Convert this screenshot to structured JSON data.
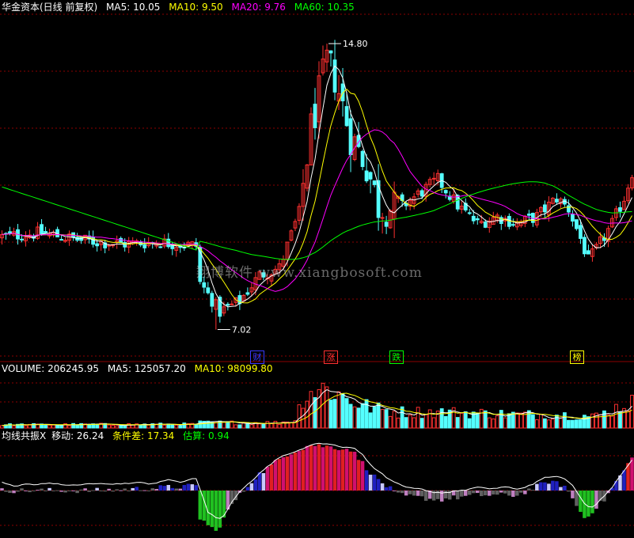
{
  "title": "华金资本(日线 前复权)",
  "main_indicators": [
    {
      "label": "MA5: 10.05",
      "color": "#ffffff"
    },
    {
      "label": "MA10: 9.50",
      "color": "#ffff00"
    },
    {
      "label": "MA20: 9.76",
      "color": "#ff00ff"
    },
    {
      "label": "MA60: 10.35",
      "color": "#00ff00"
    }
  ],
  "volume_indicators": [
    {
      "label": "VOLUME: 206245.95",
      "color": "#ffffff"
    },
    {
      "label": "MA5: 125057.20",
      "color": "#ffffff"
    },
    {
      "label": "MA10: 98099.80",
      "color": "#ffff00"
    }
  ],
  "osc_indicators": [
    {
      "label": "均线共振X",
      "color": "#ffffff"
    },
    {
      "label": "移动: 26.24",
      "color": "#ffffff"
    },
    {
      "label": "条件差: 17.34",
      "color": "#ffff00"
    },
    {
      "label": "估算: 0.94",
      "color": "#00ff00"
    }
  ],
  "high_marker": "14.80",
  "low_marker": "7.02",
  "event_tags": [
    {
      "text": "财",
      "color": "#3a3aff"
    },
    {
      "text": "涨",
      "color": "#ff3030"
    },
    {
      "text": "跌",
      "color": "#00ff00"
    },
    {
      "text": "榜",
      "color": "#ffff00"
    }
  ],
  "watermark": "翔博软件 www.xiangbosoft.com",
  "colors": {
    "up": "#ff3030",
    "down": "#54ffff",
    "grid": "#8b0000"
  },
  "chart_data": {
    "type": "candlestick",
    "price_range": [
      6.3,
      15.6
    ],
    "annotations": {
      "high": 14.8,
      "low": 7.02
    },
    "anchors": [
      [
        0,
        9.55
      ],
      [
        10,
        9.65
      ],
      [
        20,
        9.45
      ],
      [
        30,
        9.35
      ],
      [
        40,
        9.4
      ],
      [
        49,
        9.3
      ],
      [
        50,
        8.3
      ],
      [
        55,
        7.5
      ],
      [
        60,
        7.8
      ],
      [
        65,
        8.5
      ],
      [
        70,
        8.7
      ],
      [
        75,
        10.2
      ],
      [
        78,
        12.5
      ],
      [
        82,
        14.3
      ],
      [
        84,
        13.9
      ],
      [
        88,
        12.3
      ],
      [
        92,
        11.5
      ],
      [
        95,
        10.4
      ],
      [
        100,
        10.3
      ],
      [
        105,
        10.7
      ],
      [
        110,
        11.1
      ],
      [
        115,
        10.4
      ],
      [
        120,
        9.9
      ],
      [
        125,
        10.1
      ],
      [
        130,
        9.9
      ],
      [
        135,
        10.1
      ],
      [
        140,
        10.6
      ],
      [
        143,
        10.3
      ],
      [
        146,
        9.5
      ],
      [
        148,
        8.9
      ],
      [
        150,
        9.2
      ],
      [
        154,
        9.9
      ],
      [
        157,
        10.6
      ],
      [
        159,
        11.3
      ]
    ],
    "vol_anchors": [
      [
        0,
        0.06
      ],
      [
        49,
        0.07
      ],
      [
        50,
        0.1
      ],
      [
        70,
        0.1
      ],
      [
        74,
        0.15
      ],
      [
        76,
        0.6
      ],
      [
        78,
        0.7
      ],
      [
        82,
        0.75
      ],
      [
        86,
        0.6
      ],
      [
        90,
        0.45
      ],
      [
        95,
        0.35
      ],
      [
        100,
        0.3
      ],
      [
        110,
        0.3
      ],
      [
        120,
        0.28
      ],
      [
        130,
        0.25
      ],
      [
        140,
        0.25
      ],
      [
        150,
        0.22
      ],
      [
        159,
        0.5
      ]
    ],
    "osc_anchors": [
      [
        0,
        0
      ],
      [
        25,
        0
      ],
      [
        49,
        0.1
      ],
      [
        50,
        -0.6
      ],
      [
        54,
        -0.9
      ],
      [
        58,
        -0.3
      ],
      [
        64,
        0.3
      ],
      [
        72,
        0.8
      ],
      [
        78,
        1.0
      ],
      [
        88,
        0.9
      ],
      [
        94,
        0.3
      ],
      [
        100,
        -0.1
      ],
      [
        110,
        -0.2
      ],
      [
        120,
        -0.1
      ],
      [
        130,
        -0.1
      ],
      [
        138,
        0.2
      ],
      [
        142,
        0.1
      ],
      [
        147,
        -0.6
      ],
      [
        152,
        -0.2
      ],
      [
        159,
        0.7
      ]
    ]
  }
}
